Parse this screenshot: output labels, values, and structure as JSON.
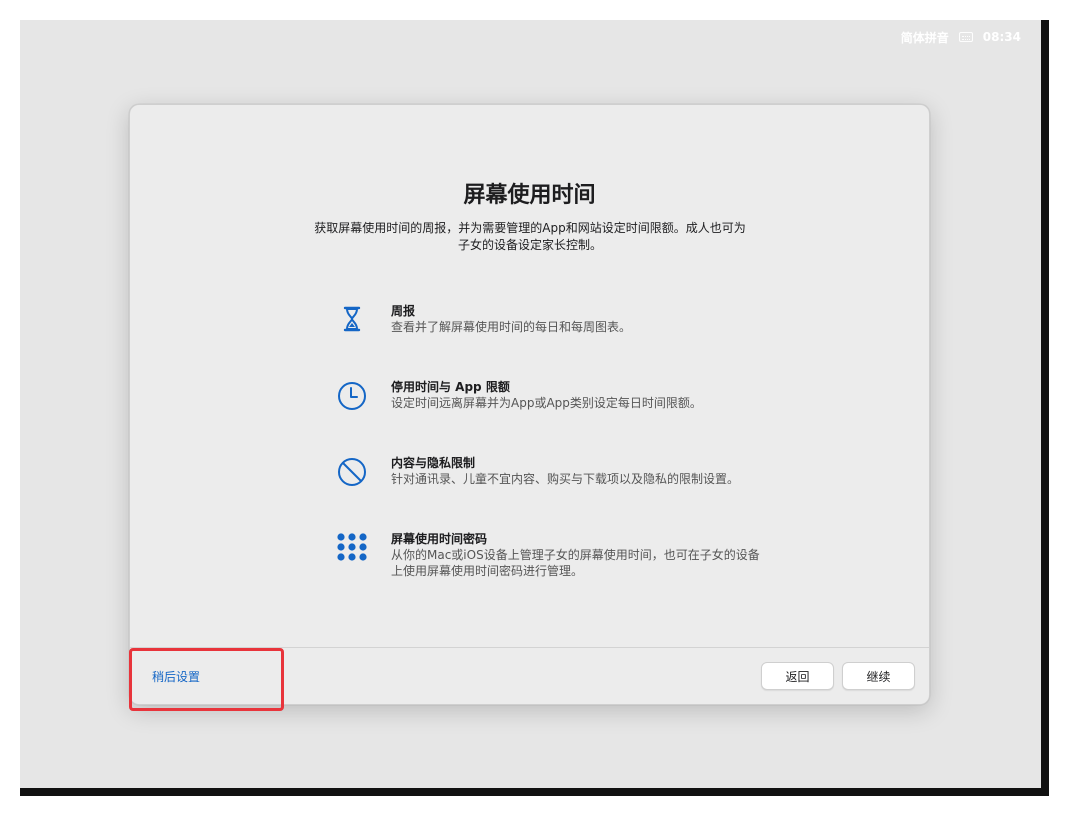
{
  "statusbar": {
    "input_method": "简体拼音",
    "time": "08:34"
  },
  "dialog": {
    "title": "屏幕使用时间",
    "subtitle": "获取屏幕使用时间的周报，并为需要管理的App和网站设定时间限额。成人也可为子女的设备设定家长控制。",
    "features": [
      {
        "icon": "hourglass-icon",
        "title": "周报",
        "description": "查看并了解屏幕使用时间的每日和每周图表。"
      },
      {
        "icon": "clock-icon",
        "title": "停用时间与 App 限额",
        "description": "设定时间远离屏幕并为App或App类别设定每日时间限额。"
      },
      {
        "icon": "prohibited-icon",
        "title": "内容与隐私限制",
        "description": "针对通讯录、儿童不宜内容、购买与下载项以及隐私的限制设置。"
      },
      {
        "icon": "passcode-keypad-icon",
        "title": "屏幕使用时间密码",
        "description": "从你的Mac或iOS设备上管理子女的屏幕使用时间，也可在子女的设备上使用屏幕使用时间密码进行管理。"
      }
    ],
    "later_link": "稍后设置",
    "back_button": "返回",
    "continue_button": "继续"
  },
  "colors": {
    "accent": "#1466c6",
    "highlight": "#e8343b",
    "background": "#e6e6e6"
  }
}
